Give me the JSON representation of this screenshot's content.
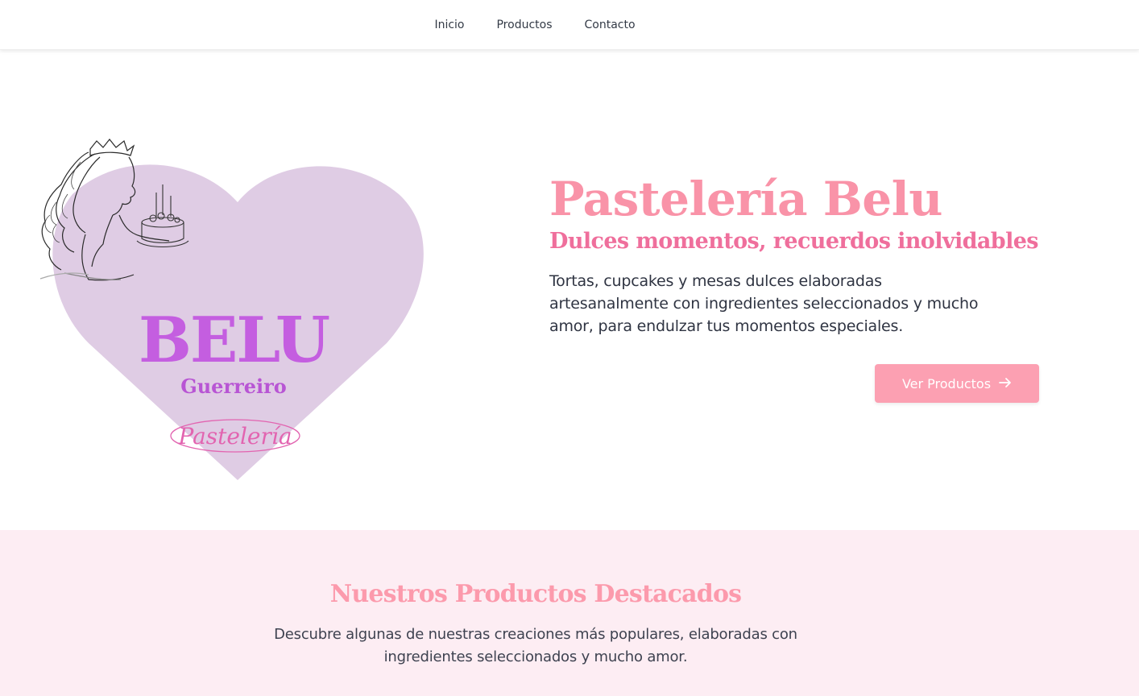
{
  "nav": {
    "items": [
      {
        "label": "Inicio"
      },
      {
        "label": "Productos"
      },
      {
        "label": "Contacto"
      }
    ]
  },
  "logo": {
    "name": "BELU",
    "surname": "Guerreiro",
    "tag": "Pastelería",
    "colors": {
      "heart": "#dfcce4",
      "name": "#c45ee0",
      "tag": "#e264b0"
    }
  },
  "hero": {
    "title": "Pastelería Belu",
    "subtitle": "Dulces momentos, recuerdos inolvidables",
    "description": "Tortas, cupcakes y mesas dulces elaboradas artesanalmente con ingredientes seleccionados y mucho amor, para endulzar tus momentos especiales.",
    "cta_label": "Ver Productos",
    "cta_icon": "arrow-right-icon"
  },
  "featured": {
    "title": "Nuestros Productos Destacados",
    "description": "Descubre algunas de nuestras creaciones más populares, elaboradas con ingredientes seleccionados y mucho amor."
  },
  "colors": {
    "accent": "#fca0b2",
    "title": "#f993a8",
    "subtitle": "#ef6f9c",
    "section_bg": "#fdedf3"
  }
}
